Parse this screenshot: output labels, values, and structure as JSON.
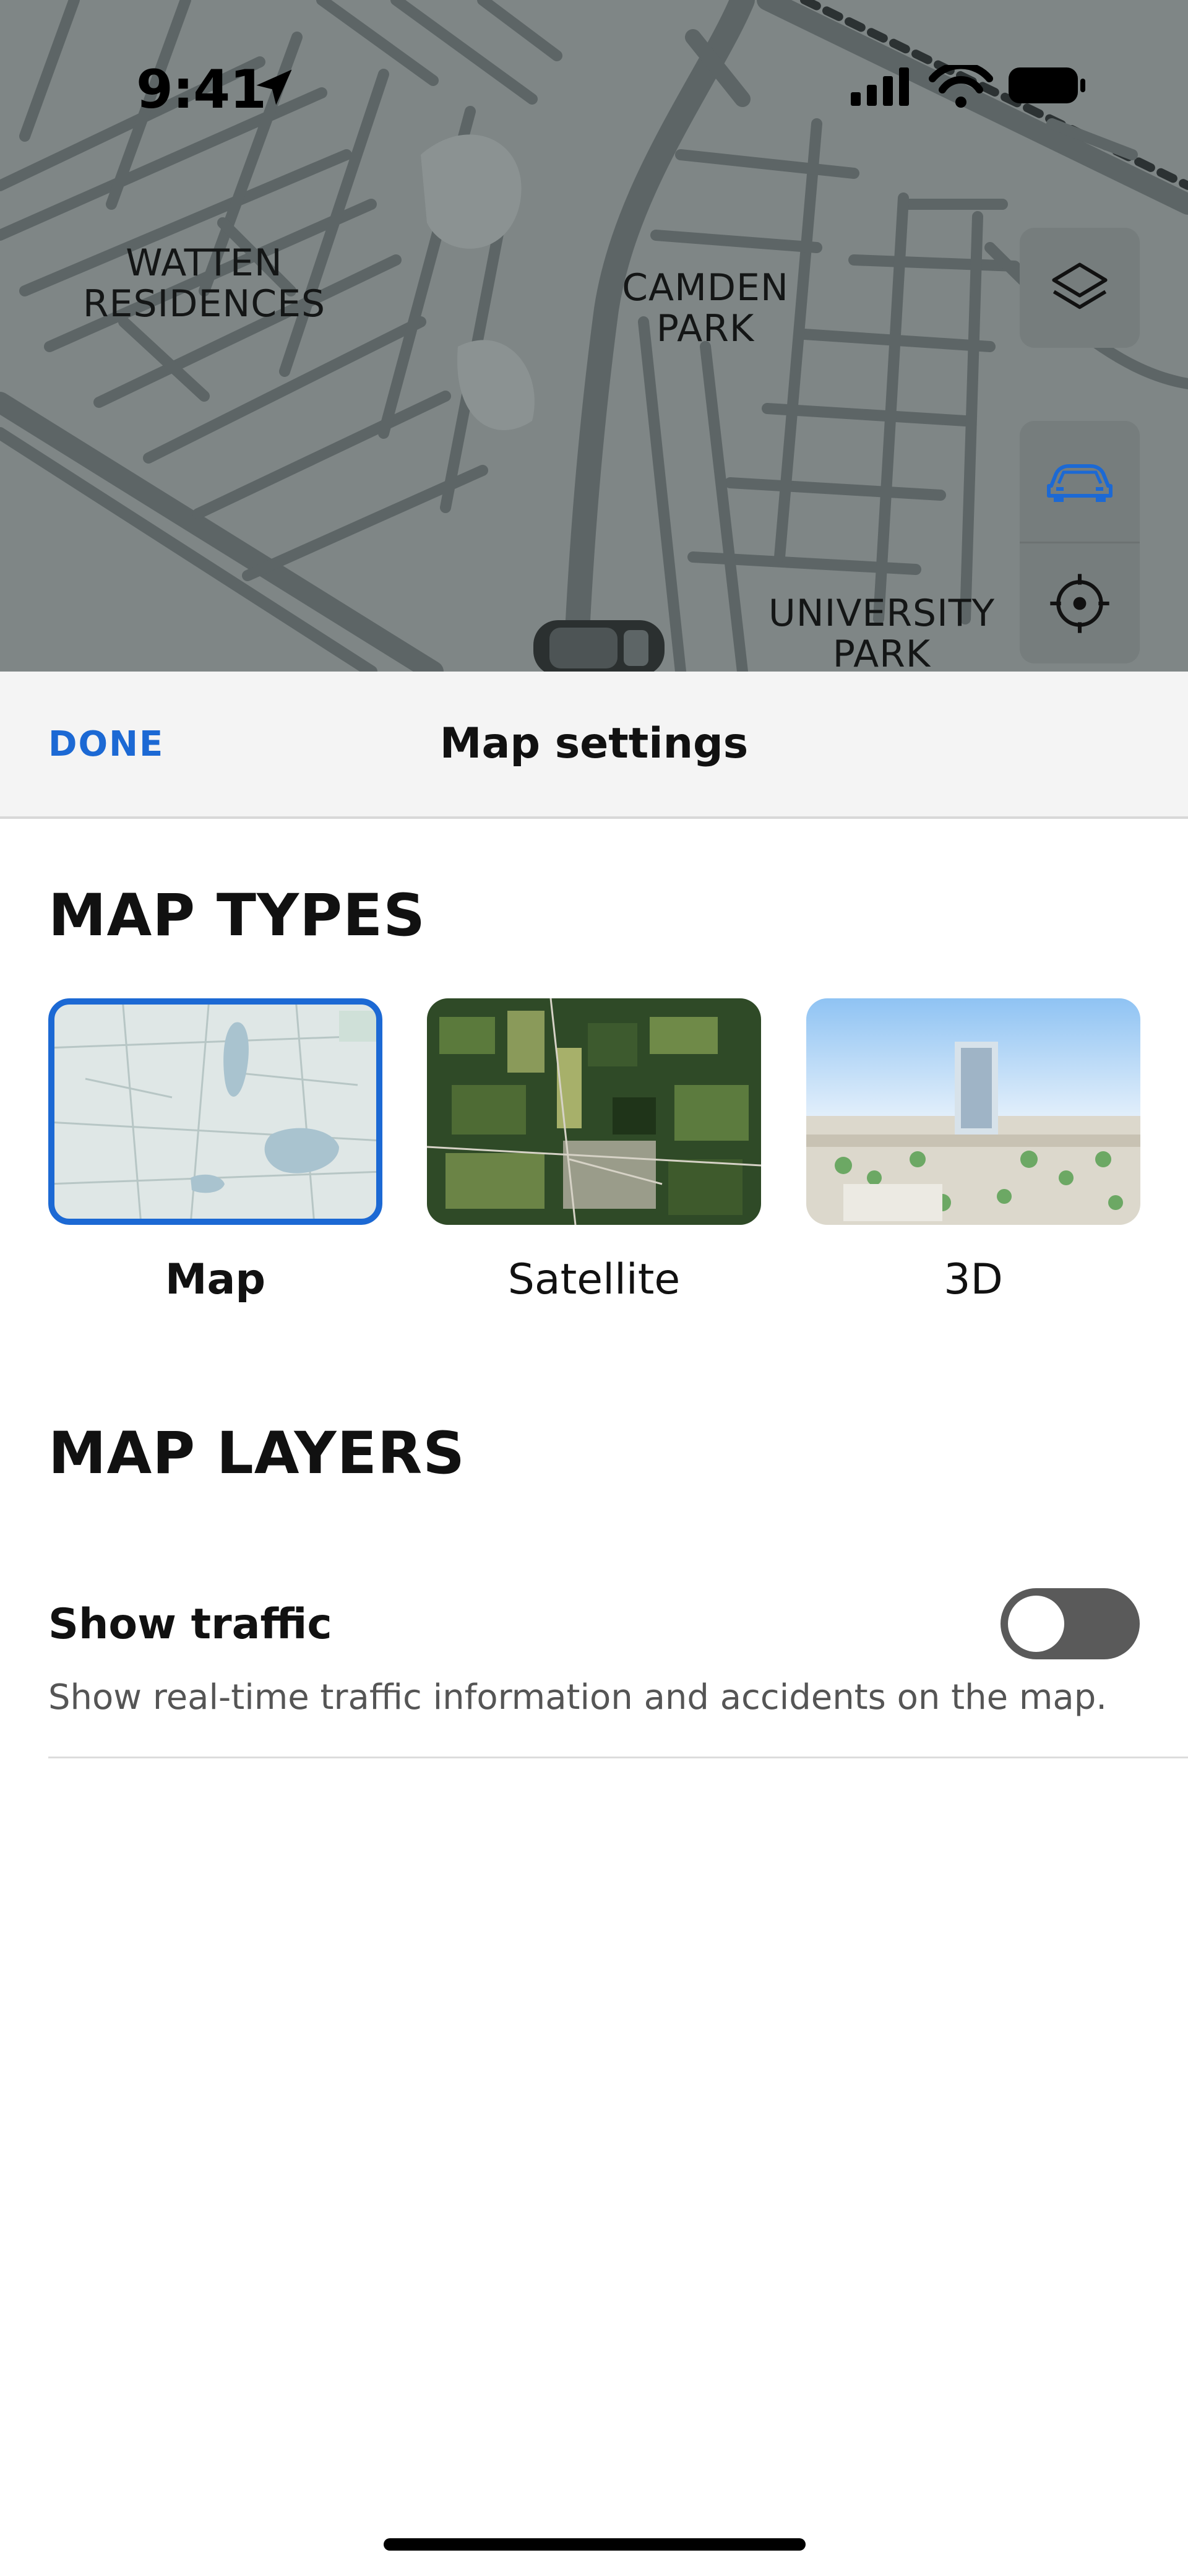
{
  "status_bar": {
    "time": "9:41"
  },
  "map": {
    "labels": {
      "watten": "WATTEN\nRESIDENCES",
      "camden": "CAMDEN\nPARK",
      "university": "UNIVERSITY\nPARK"
    },
    "colors": {
      "background": "#7f8686",
      "roads": "#5d6566",
      "accent": "#1c69d4"
    }
  },
  "sheet": {
    "done_label": "DONE",
    "title": "Map settings",
    "map_types_heading": "MAP TYPES",
    "map_types": [
      {
        "label": "Map",
        "selected": true,
        "icon": "map-thumbnail"
      },
      {
        "label": "Satellite",
        "selected": false,
        "icon": "satellite-thumbnail"
      },
      {
        "label": "3D",
        "selected": false,
        "icon": "3d-thumbnail"
      }
    ],
    "map_layers_heading": "MAP LAYERS",
    "traffic": {
      "title": "Show traffic",
      "description": "Show real-time traffic information and accidents on the map.",
      "enabled": false
    }
  }
}
